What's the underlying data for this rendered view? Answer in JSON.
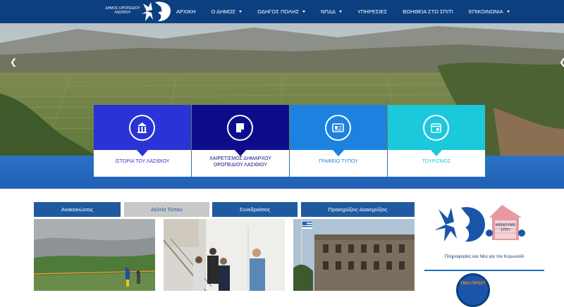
{
  "header": {
    "brand_line1": "ΔΗΜΟΣ ΟΡΟΠΕΔΙΟΥ",
    "brand_line2": "ΛΑΣΙΘΙΟΥ",
    "nav": [
      {
        "label": "ΑΡΧΙΚΗ",
        "has_dropdown": false
      },
      {
        "label": "Ο ΔΗΜΟΣ",
        "has_dropdown": true
      },
      {
        "label": "ΟΔΗΓΟΣ ΠΟΛΗΣ",
        "has_dropdown": true
      },
      {
        "label": "ΝΠΔΔ",
        "has_dropdown": true
      },
      {
        "label": "ΥΠΗΡΕΣΙΕΣ",
        "has_dropdown": false
      },
      {
        "label": "ΒΟΗΘΕΙΑ ΣΤΟ ΣΠΙΤΙ",
        "has_dropdown": false
      },
      {
        "label": "ΕΠΙΚΟΙΝΩΝΙΑ",
        "has_dropdown": true
      }
    ]
  },
  "hero": {
    "prev_icon": "chevron-left-icon",
    "next_icon": "chevron-right-icon"
  },
  "tiles": [
    {
      "label": "ΙΣΤΟΡΙΑ ΤΟΥ ΛΑΣΙΘΙΟΥ",
      "icon": "bank-icon",
      "color": "#2a34d6"
    },
    {
      "label": "ΧΑΙΡΕΤΙΣΜΟΣ ΔΗΜΑΡΧΟΥ ΟΡΟΠΕΔΙΟΥ ΛΑΣΙΘΙΟΥ",
      "icon": "note-icon",
      "color": "#0d0d8c"
    },
    {
      "label": "ΓΡΑΦΕΙΟ ΤΥΠΟΥ",
      "icon": "newspaper-icon",
      "color": "#1b82e0"
    },
    {
      "label": "ΤΟΥΡΙΣΜΟΣ",
      "icon": "calendar-icon",
      "color": "#1cc8dc"
    }
  ],
  "tabs": [
    {
      "label": "Ανακοινώσεις",
      "active": false
    },
    {
      "label": "Δελτία Τύπου",
      "active": true
    },
    {
      "label": "Συνεδριάσεις",
      "active": false
    },
    {
      "label": "Προκηρύξεις-Διακηρύξεις",
      "active": false
    }
  ],
  "sidebar": {
    "corona_sign": "ΜΕΝΟΥΜΕ ΣΠΙΤΙ",
    "corona_caption": "Πληροφορίες και Νέα για τον Κορωνοϊό",
    "civil_protection": "ΤΙΚΗ ΠΡΟΣΤ"
  },
  "colors": {
    "topbar": "#0b3f7f",
    "tab_blue": "#1f5aa0",
    "tab_active": "#c8c8c8"
  }
}
